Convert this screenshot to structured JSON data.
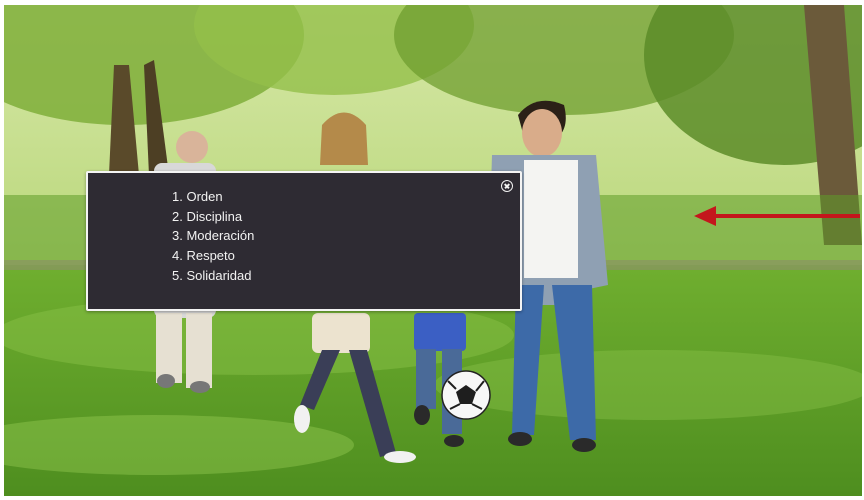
{
  "popup": {
    "items": [
      "1. Orden",
      "2. Disciplina",
      "3. Moderación",
      "4. Respeto",
      "5. Solidaridad"
    ]
  },
  "icons": {
    "close": "close-circle-icon",
    "pointer": "left-arrow-icon"
  },
  "colors": {
    "popup_background": "#2e2b33",
    "popup_border": "#f4f4f4",
    "popup_text": "#f2f2f2",
    "arrow": "#c4161c"
  }
}
